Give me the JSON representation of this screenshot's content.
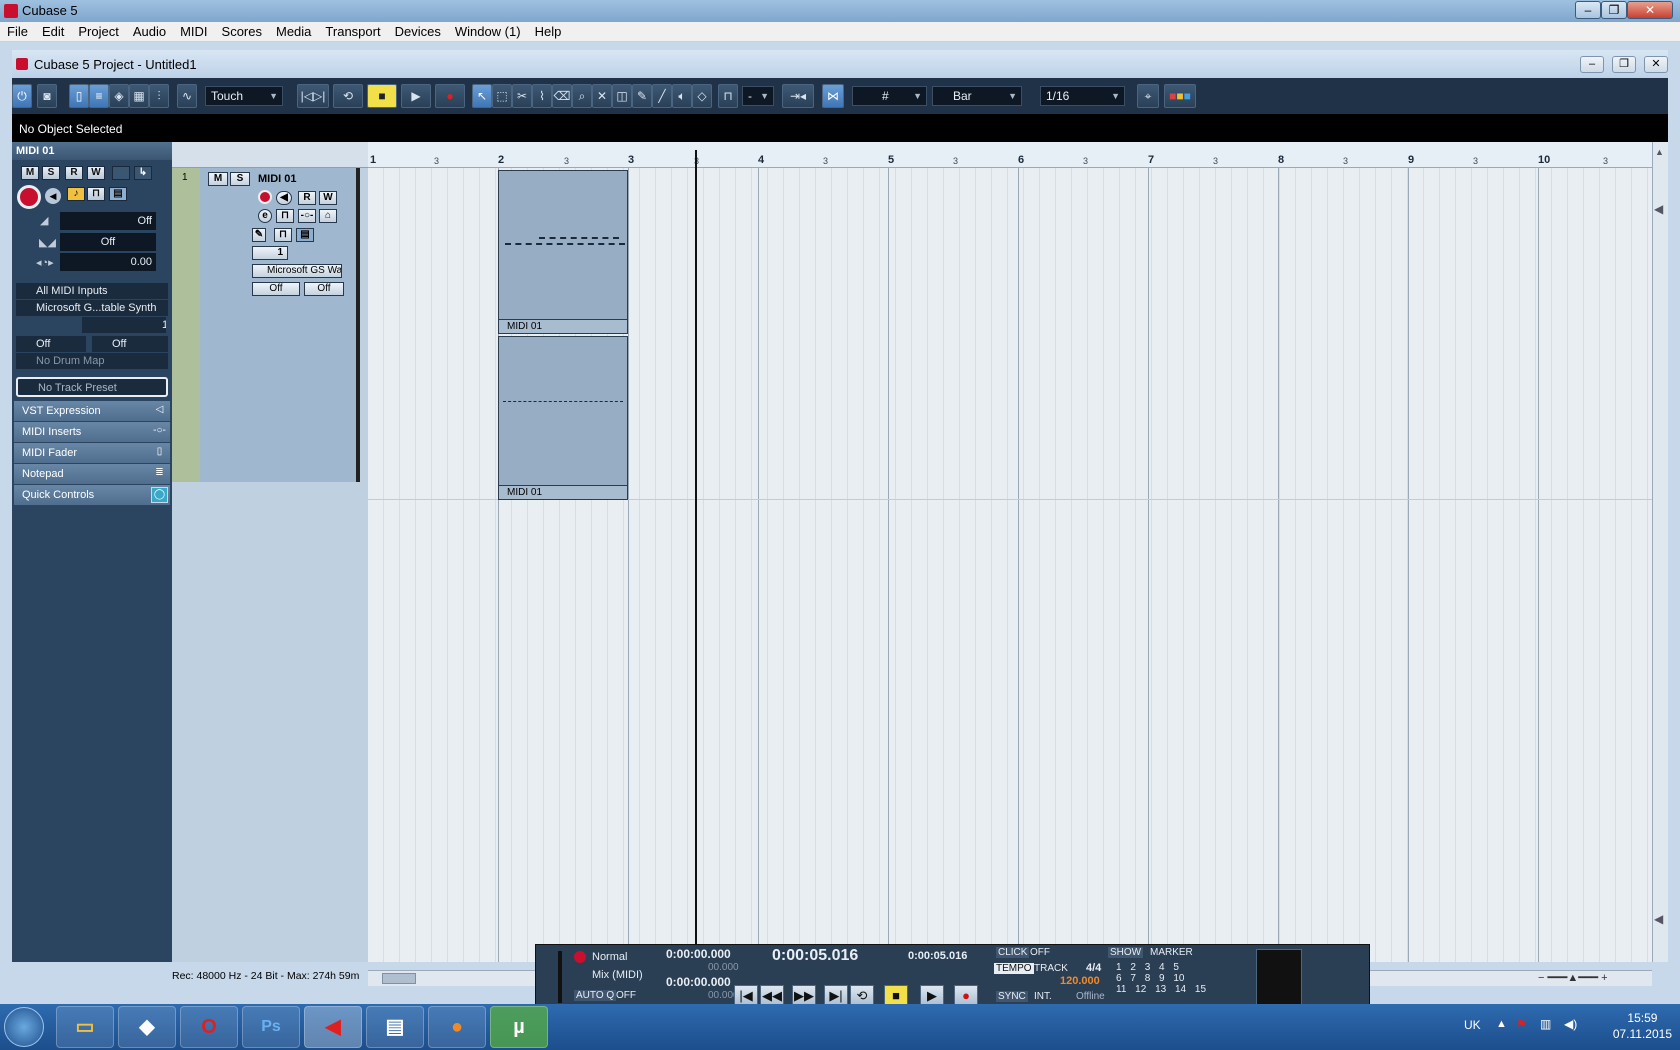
{
  "app": {
    "title": "Cubase 5"
  },
  "menu": [
    "File",
    "Edit",
    "Project",
    "Audio",
    "MIDI",
    "Scores",
    "Media",
    "Transport",
    "Devices",
    "Window (1)",
    "Help"
  ],
  "project": {
    "title": "Cubase 5 Project - Untitled1"
  },
  "toolbar": {
    "automation_mode": "Touch",
    "quantize_dash": "-",
    "grid_type": "Bar",
    "quantize_value": "1/16"
  },
  "info_line": "No Object Selected",
  "inspector": {
    "track_name": "MIDI 01",
    "buttons": [
      "M",
      "S",
      "R",
      "W"
    ],
    "volume_value": "Off",
    "pan_value": "Off",
    "delay_value": "0.00",
    "input": "All MIDI Inputs",
    "output": "Microsoft G...table Synth",
    "channel": "1",
    "bank": "Off",
    "program": "Off",
    "drum_map": "No Drum Map",
    "track_preset": "No Track Preset",
    "sections": [
      "VST Expression",
      "MIDI Inserts",
      "MIDI Fader",
      "Notepad",
      "Quick Controls"
    ]
  },
  "track": {
    "number": "1",
    "name": "MIDI 01",
    "buttons": [
      "M",
      "S",
      "R",
      "W"
    ],
    "channel": "1",
    "output": "Microsoft GS Wa",
    "bank": "Off",
    "program": "Off"
  },
  "ruler": {
    "bars": [
      "1",
      "2",
      "3",
      "4",
      "5",
      "6",
      "7",
      "8",
      "9",
      "10"
    ],
    "sub": "3"
  },
  "parts": [
    {
      "label": "MIDI 01"
    },
    {
      "label": "MIDI 01"
    }
  ],
  "status_rec": "Rec: 48000 Hz - 24 Bit - Max: 274h 59m",
  "transport": {
    "mode1": "Normal",
    "mode2": "Mix (MIDI)",
    "autoq": "AUTO Q",
    "autoq_state": "OFF",
    "left_locator": "0:00:00.000",
    "left_sub": "00.000",
    "right_locator": "0:00:00.000",
    "right_sub": "00.000",
    "main_time": "0:00:05.016",
    "secondary_time": "0:00:05.016",
    "click_label": "CLICK",
    "click_state": "OFF",
    "tempo_label": "TEMPO",
    "track_label": "TRACK",
    "signature": "4/4",
    "tempo": "120.000",
    "sync_label": "SYNC",
    "sync_mode": "INT.",
    "sync_state": "Offline",
    "show_label": "SHOW",
    "marker_label": "MARKER",
    "markers": [
      "1",
      "2",
      "3",
      "4",
      "5",
      "6",
      "7",
      "8",
      "9",
      "10",
      "11",
      "12",
      "13",
      "14",
      "15"
    ]
  },
  "taskbar": {
    "lang": "UK",
    "time": "15:59",
    "date": "07.11.2015"
  },
  "colors": {
    "accent": "#3f76b6",
    "record": "#c8102e",
    "tempo": "#f08a28"
  }
}
